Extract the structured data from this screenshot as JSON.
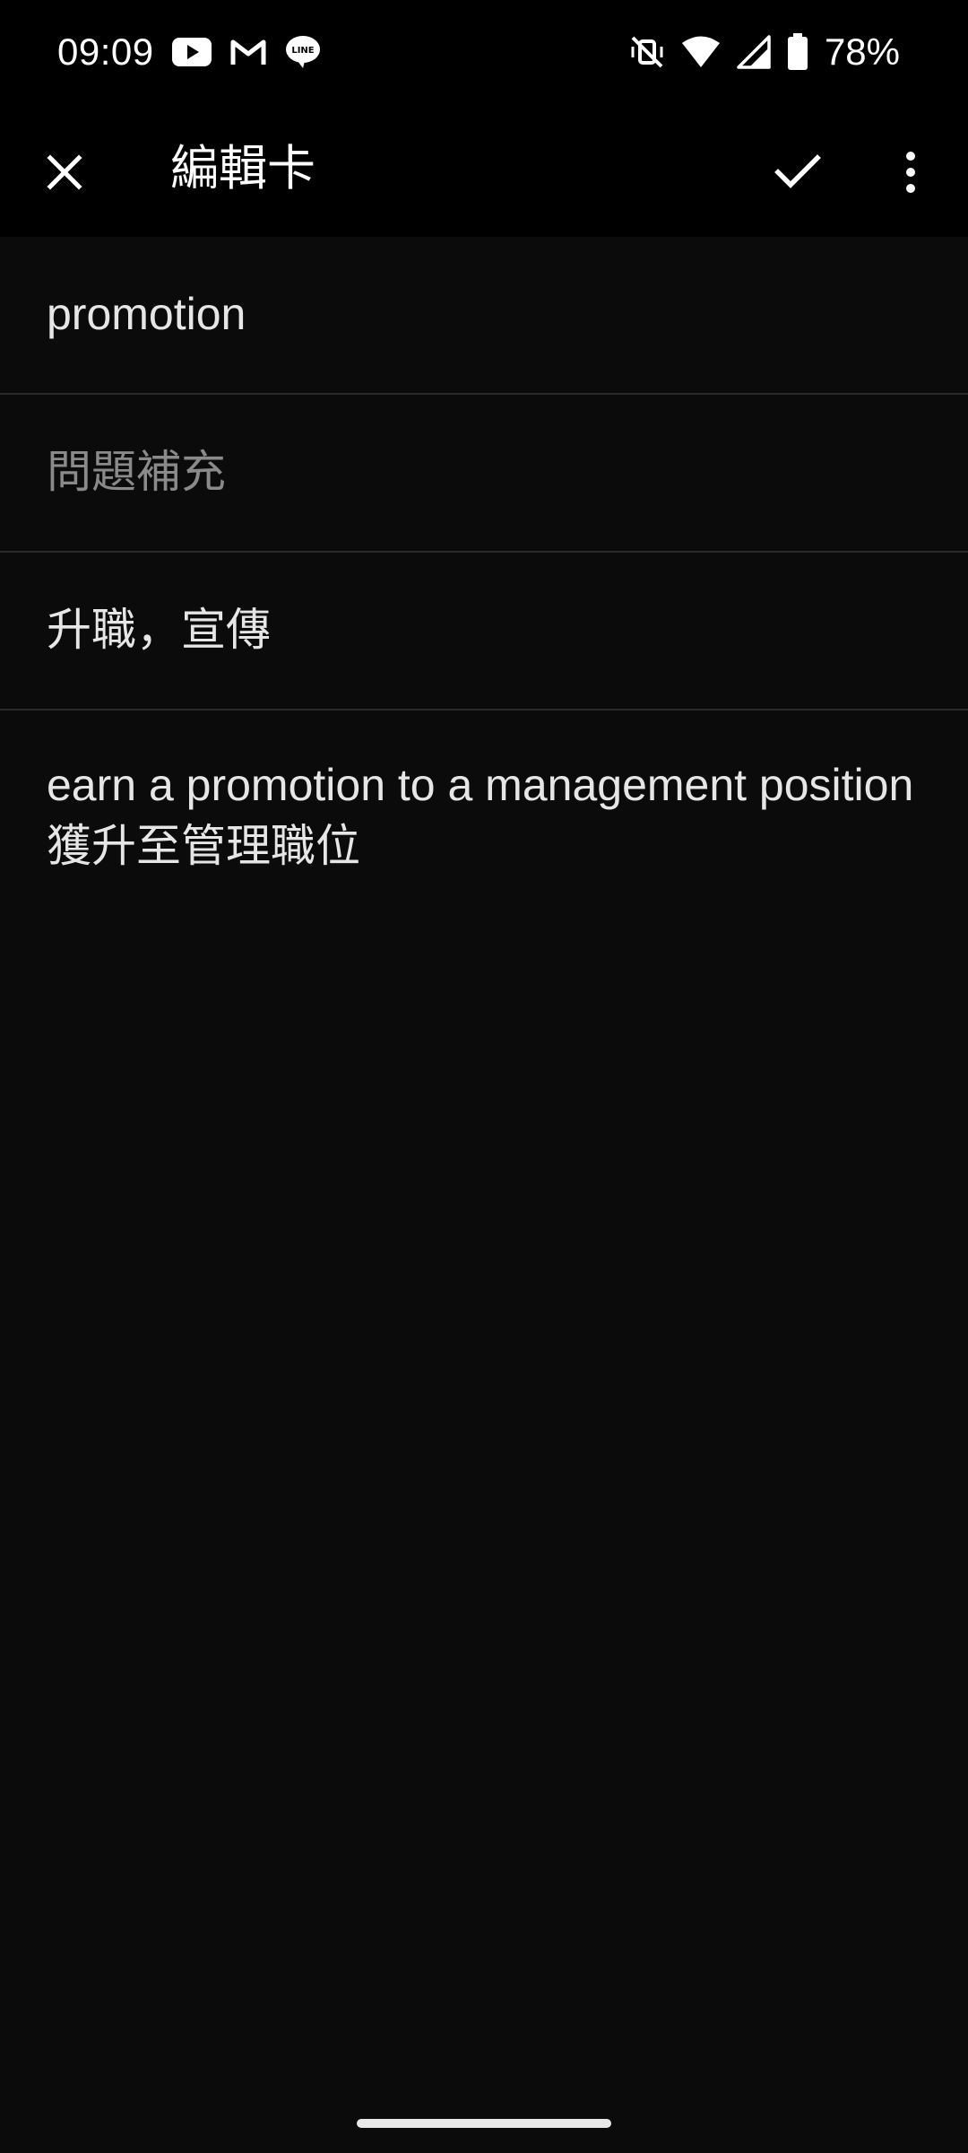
{
  "status_bar": {
    "time": "09:09",
    "notification_icons": [
      "youtube-icon",
      "gmail-icon",
      "line-icon"
    ],
    "system_icons": [
      "mute-vibrate-off-icon",
      "wifi-icon",
      "cellular-signal-icon",
      "battery-icon"
    ],
    "battery_percent": "78%"
  },
  "app_bar": {
    "title": "編輯卡",
    "close_icon": "close-icon",
    "confirm_icon": "check-icon",
    "more_icon": "more-vert-icon"
  },
  "card": {
    "front": "promotion",
    "question_placeholder": "問題補充",
    "back": "升職，宣傳",
    "example_en": "earn a promotion to a management position",
    "example_zh": "獲升至管理職位"
  },
  "colors": {
    "background": "#0b0b0b",
    "bar": "#000000",
    "text": "#e6e6e6",
    "hint": "#8a8a8a",
    "divider": "#2a2a2a"
  }
}
